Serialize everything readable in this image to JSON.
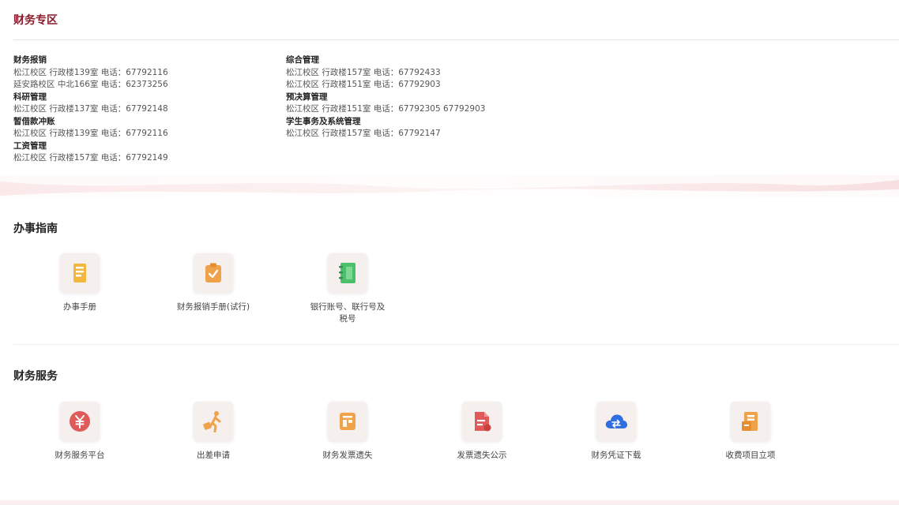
{
  "page": {
    "title": "财务专区"
  },
  "contacts": {
    "col1": [
      {
        "name": "财务报销",
        "lines": [
          "松江校区 行政楼139室 电话：67792116",
          "延安路校区 中北166室 电话：62373256"
        ]
      },
      {
        "name": "科研管理",
        "lines": [
          "松江校区 行政楼137室 电话：67792148"
        ]
      },
      {
        "name": "暂借款冲账",
        "lines": [
          "松江校区 行政楼139室 电话：67792116"
        ]
      },
      {
        "name": "工资管理",
        "lines": [
          "松江校区 行政楼157室 电话：67792149"
        ]
      }
    ],
    "col2": [
      {
        "name": "综合管理",
        "lines": [
          "松江校区 行政楼157室 电话：67792433",
          "松江校区 行政楼151室 电话：67792903"
        ]
      },
      {
        "name": "预决算管理",
        "lines": [
          "松江校区 行政楼151室 电话：67792305 67792903"
        ]
      },
      {
        "name": "学生事务及系统管理",
        "lines": [
          "松江校区 行政楼157室 电话：67792147"
        ]
      }
    ]
  },
  "guide": {
    "title": "办事指南",
    "items": [
      {
        "label": "办事手册",
        "icon": "handbook-icon",
        "color": "#f3b73f"
      },
      {
        "label": "财务报销手册(试行)",
        "icon": "checklist-icon",
        "color": "#f0a24a"
      },
      {
        "label": "银行账号、联行号及税号",
        "icon": "notebook-icon",
        "color": "#4cbf6b"
      }
    ]
  },
  "services": {
    "title": "财务服务",
    "items": [
      {
        "label": "财务服务平台",
        "icon": "yuan-icon",
        "color": "#e05a5a"
      },
      {
        "label": "出差申请",
        "icon": "traveler-icon",
        "color": "#f0a24a"
      },
      {
        "label": "财务发票遗失",
        "icon": "invoice-icon",
        "color": "#f0a24a"
      },
      {
        "label": "发票遗失公示",
        "icon": "document-icon",
        "color": "#e05a5a"
      },
      {
        "label": "财务凭证下载",
        "icon": "cloud-icon",
        "color": "#2f6fe0"
      },
      {
        "label": "收费项目立项",
        "icon": "project-icon",
        "color": "#f0a24a"
      }
    ]
  }
}
